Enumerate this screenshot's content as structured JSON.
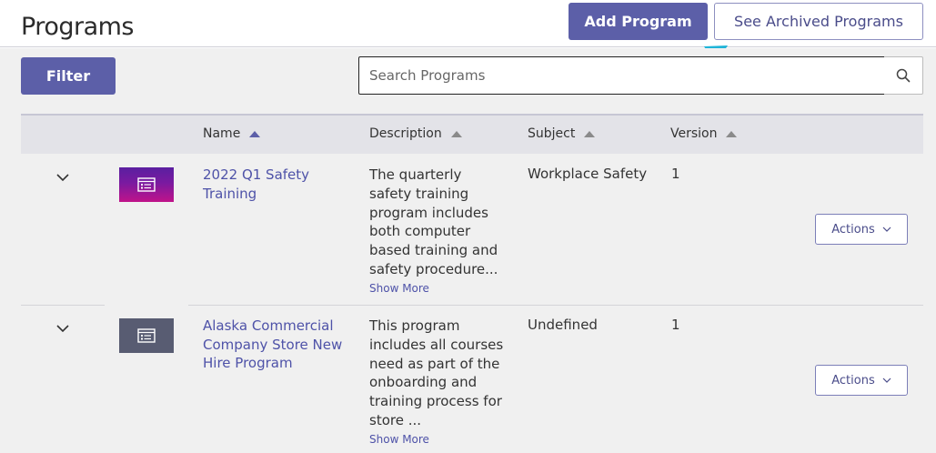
{
  "header": {
    "title": "Programs",
    "add_program_label": "Add Program",
    "archived_label": "See Archived Programs"
  },
  "toolbar": {
    "filter_label": "Filter",
    "search_placeholder": "Search Programs"
  },
  "table": {
    "columns": [
      "Name",
      "Description",
      "Subject",
      "Version"
    ],
    "rows": [
      {
        "name": "2022 Q1 Safety Training",
        "description": "The quarterly safety training program includes both computer based training and safety procedure...",
        "show_more": "Show More",
        "subject": "Workplace Safety",
        "version": "1",
        "actions_label": "Actions"
      },
      {
        "name": "Alaska Commercial Company Store New Hire Program",
        "description": "This program includes all courses need as part of the onboarding and training process for store ...",
        "show_more": "Show More",
        "subject": "Undefined",
        "version": "1",
        "actions_label": "Actions"
      }
    ]
  },
  "colors": {
    "primary": "#5c5fa8",
    "link": "#4e52a8",
    "annotation_arrow": "#1fb4d8"
  }
}
